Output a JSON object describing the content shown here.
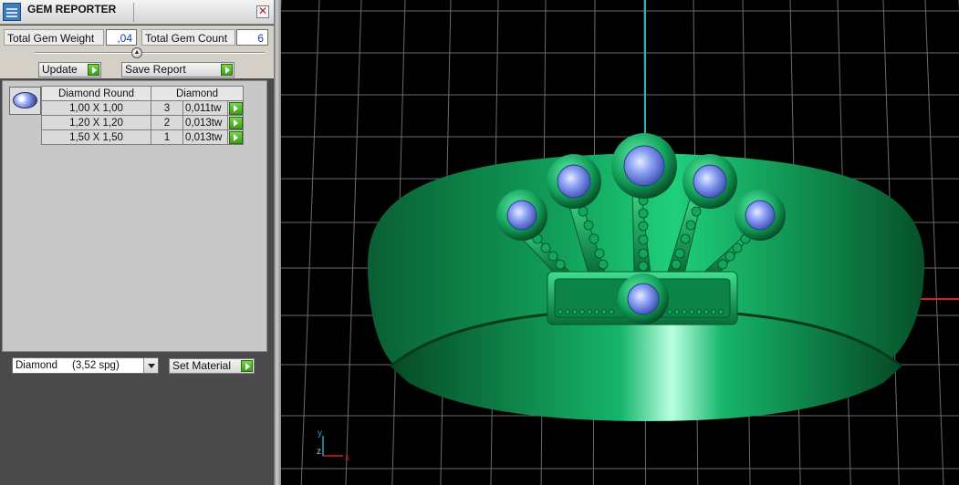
{
  "window": {
    "title": "GEM REPORTER",
    "close_glyph": "✕"
  },
  "stats": {
    "total_weight_label": "Total Gem Weight",
    "total_weight_value": ",04",
    "total_count_label": "Total Gem Count",
    "total_count_value": "6"
  },
  "toolbar": {
    "update_label": "Update",
    "save_report_label": "Save Report"
  },
  "table": {
    "header_shape": "Diamond Round",
    "header_material": "Diamond",
    "rows": [
      {
        "size": "1,00 X 1,00",
        "count": "3",
        "weight": "0,011tw"
      },
      {
        "size": "1,20 X 1,20",
        "count": "2",
        "weight": "0,013tw"
      },
      {
        "size": "1,50 X 1,50",
        "count": "1",
        "weight": "0,013tw"
      }
    ]
  },
  "material": {
    "selected": "Diamond     (3,52 spg)",
    "set_material_label": "Set Material"
  },
  "viewport": {
    "axis_y": "y",
    "axis_z": "z",
    "axis_x": "x",
    "colors": {
      "ring": "#0f8a4c",
      "gem": "#7f97f2",
      "grid": "#6b6b6b",
      "axis_cyan": "#1fb8c6",
      "axis_red": "#d42020"
    }
  }
}
